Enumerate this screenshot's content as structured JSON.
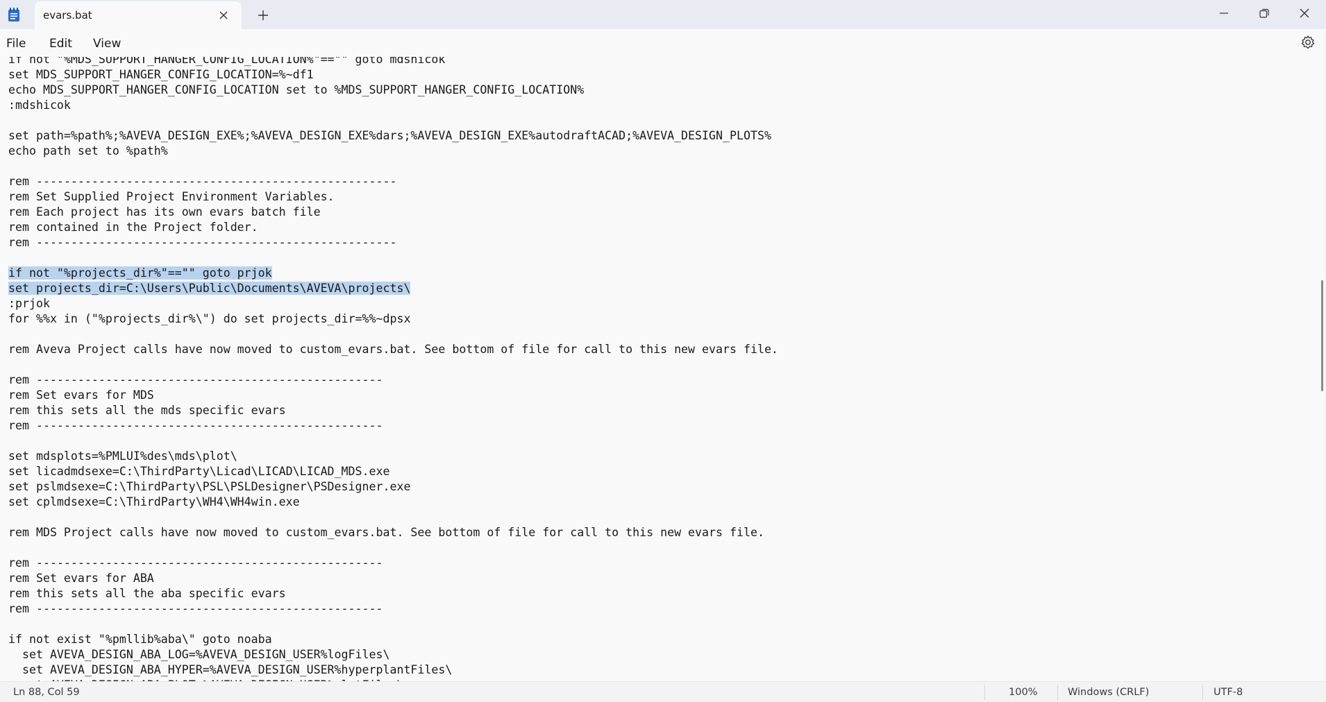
{
  "window": {
    "tab_title": "evars.bat"
  },
  "menu": {
    "file": "File",
    "edit": "Edit",
    "view": "View"
  },
  "editor": {
    "lines": [
      "if not \"%MDS_SUPPORT_HANGER_CONFIG_LOCATION%\"==\"\" goto mdshicok",
      "set MDS_SUPPORT_HANGER_CONFIG_LOCATION=%~df1",
      "echo MDS_SUPPORT_HANGER_CONFIG_LOCATION set to %MDS_SUPPORT_HANGER_CONFIG_LOCATION%",
      ":mdshicok",
      "",
      "set path=%path%;%AVEVA_DESIGN_EXE%;%AVEVA_DESIGN_EXE%dars;%AVEVA_DESIGN_EXE%autodraftACAD;%AVEVA_DESIGN_PLOTS%",
      "echo path set to %path%",
      "",
      "rem ----------------------------------------------------",
      "rem Set Supplied Project Environment Variables.",
      "rem Each project has its own evars batch file",
      "rem contained in the Project folder.",
      "rem ----------------------------------------------------",
      "",
      "if not \"%projects_dir%\"==\"\" goto prjok",
      "set projects_dir=C:\\Users\\Public\\Documents\\AVEVA\\projects\\",
      ":prjok",
      "for %%x in (\"%projects_dir%\\\") do set projects_dir=%%~dpsx",
      "",
      "rem Aveva Project calls have now moved to custom_evars.bat. See bottom of file for call to this new evars file.",
      "",
      "rem --------------------------------------------------",
      "rem Set evars for MDS",
      "rem this sets all the mds specific evars",
      "rem --------------------------------------------------",
      "",
      "set mdsplots=%PMLUI%des\\mds\\plot\\",
      "set licadmdsexe=C:\\ThirdParty\\Licad\\LICAD\\LICAD_MDS.exe",
      "set pslmdsexe=C:\\ThirdParty\\PSL\\PSLDesigner\\PSDesigner.exe",
      "set cplmdsexe=C:\\ThirdParty\\WH4\\WH4win.exe",
      "",
      "rem MDS Project calls have now moved to custom_evars.bat. See bottom of file for call to this new evars file.",
      "",
      "rem --------------------------------------------------",
      "rem Set evars for ABA",
      "rem this sets all the aba specific evars",
      "rem --------------------------------------------------",
      "",
      "if not exist \"%pmllib%aba\\\" goto noaba",
      "  set AVEVA_DESIGN_ABA_LOG=%AVEVA_DESIGN_USER%logFiles\\",
      "  set AVEVA_DESIGN_ABA_HYPER=%AVEVA_DESIGN_USER%hyperplantFiles\\",
      "  set AVEVA_DESIGN_ABA_PLOT=%AVEVA_DESIGN_USER%plotFiles\\"
    ],
    "selected_line_indices": [
      14,
      15
    ]
  },
  "status": {
    "position": "Ln 88, Col 59",
    "zoom": "100%",
    "line_ending": "Windows (CRLF)",
    "encoding": "UTF-8"
  },
  "icons": {
    "app": "notepad-icon",
    "tab_close": "close-icon",
    "new_tab": "plus-icon",
    "minimize": "minimize-icon",
    "maximize": "restore-icon",
    "close": "close-icon",
    "settings": "gear-icon"
  },
  "colors": {
    "selection": "#b8d3ee",
    "titlebar": "#e9ebf2",
    "app_icon": "#2a6fd1"
  }
}
